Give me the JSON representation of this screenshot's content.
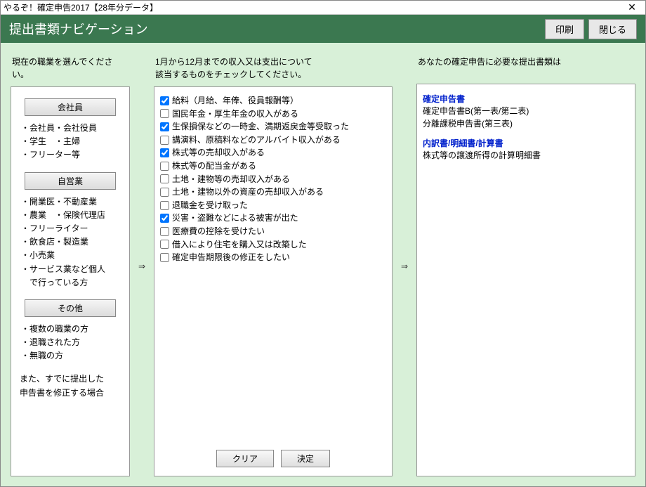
{
  "window": {
    "title": "やるぞ！確定申告2017【28年分データ】"
  },
  "header": {
    "title": "提出書類ナビゲーション",
    "print": "印刷",
    "close": "閉じる"
  },
  "left": {
    "label": "現在の職業を選んでください。",
    "cat1": {
      "title": "会社員",
      "items": [
        "・会社員・会社役員",
        "・学生　・主婦",
        "・フリーター等"
      ]
    },
    "cat2": {
      "title": "自営業",
      "items": [
        "・開業医・不動産業",
        "・農業　・保険代理店",
        "・フリーライター",
        "・飲食店・製造業",
        "・小売業",
        "・サービス業など個人",
        "　で行っている方"
      ]
    },
    "cat3": {
      "title": "その他",
      "items": [
        "・複数の職業の方",
        "・退職された方",
        "・無職の方"
      ]
    },
    "note": "また、すでに提出した\n申告書を修正する場合"
  },
  "arrow": "⇒",
  "middle": {
    "label": "1月から12月までの収入又は支出について\n該当するものをチェックしてください。",
    "items": [
      {
        "label": "給料（月給、年俸、役員報酬等）",
        "checked": true
      },
      {
        "label": "国民年金・厚生年金の収入がある",
        "checked": false
      },
      {
        "label": "生保損保などの一時金、満期返戻金等受取った",
        "checked": true
      },
      {
        "label": "講演料、原稿料などのアルバイト収入がある",
        "checked": false
      },
      {
        "label": "株式等の売却収入がある",
        "checked": true
      },
      {
        "label": "株式等の配当金がある",
        "checked": false
      },
      {
        "label": "土地・建物等の売却収入がある",
        "checked": false
      },
      {
        "label": "土地・建物以外の資産の売却収入がある",
        "checked": false
      },
      {
        "label": "退職金を受け取った",
        "checked": false
      },
      {
        "label": "災害・盗難などによる被害が出た",
        "checked": true
      },
      {
        "label": "医療費の控除を受けたい",
        "checked": false
      },
      {
        "label": "借入により住宅を購入又は改築した",
        "checked": false
      },
      {
        "label": "確定申告期限後の修正をしたい",
        "checked": false
      }
    ],
    "clear": "クリア",
    "ok": "決定"
  },
  "right": {
    "label": "あなたの確定申告に必要な提出書類は",
    "groups": [
      {
        "head": "確定申告書",
        "lines": [
          "確定申告書B(第一表/第二表)",
          "分離課税申告書(第三表)"
        ]
      },
      {
        "head": "内訳書/明細書/計算書",
        "lines": [
          "株式等の譲渡所得の計算明細書"
        ]
      }
    ]
  }
}
